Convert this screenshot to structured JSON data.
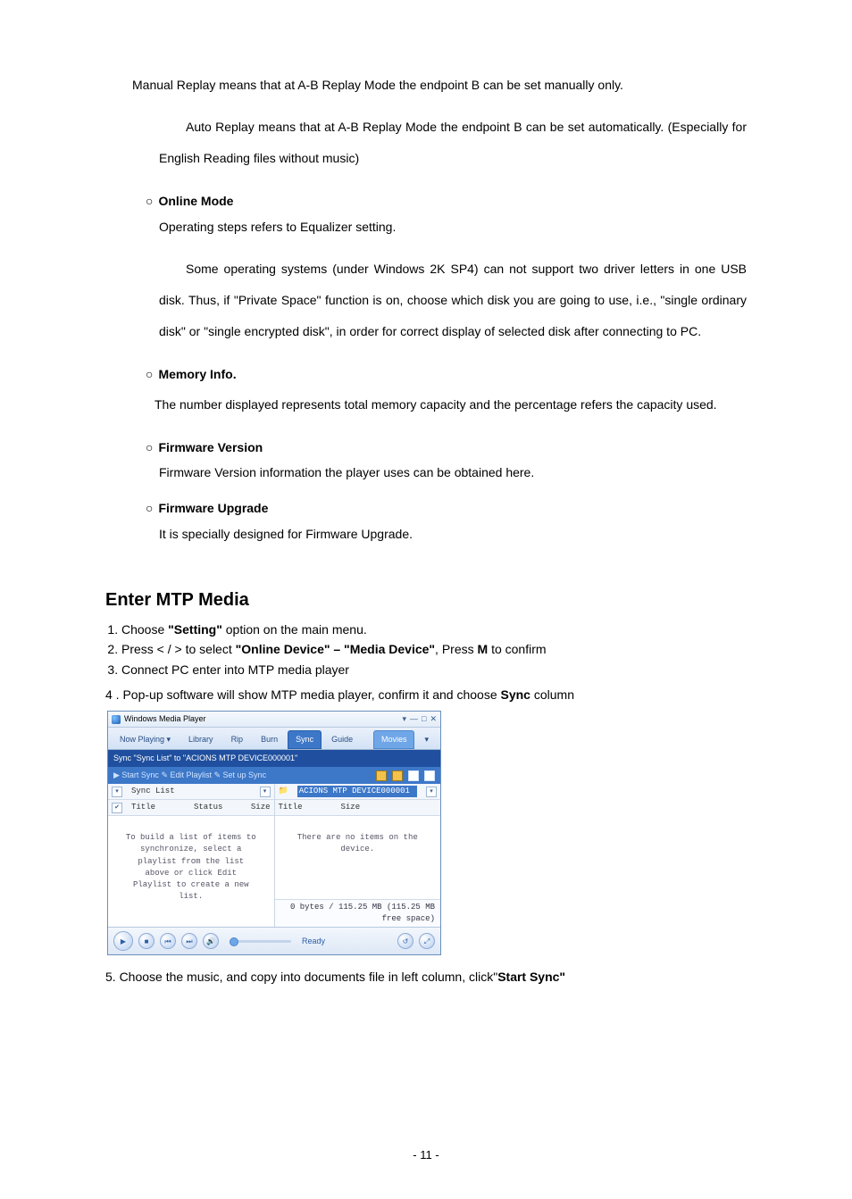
{
  "p_manual": "Manual Replay means that at A-B Replay Mode the endpoint B can be set manually only.",
  "p_auto": "Auto Replay means that at A-B Replay Mode the endpoint B can be set automatically. (Especially for English Reading files without music)",
  "bullet": "○",
  "h_online": "Online Mode",
  "p_online1": "Operating steps refers to Equalizer setting.",
  "p_online2": "Some operating systems (under Windows 2K SP4) can not support two driver letters in one USB disk. Thus, if \"Private Space\" function is on, choose which disk you are going to use, i.e., \"single ordinary disk\" or \"single encrypted disk\", in order for correct display of selected disk after connecting to PC.",
  "h_memory": "Memory Info.",
  "p_memory": "The number displayed represents total memory capacity and the percentage refers the capacity used.",
  "h_fwver": "Firmware Version",
  "p_fwver": "Firmware Version information the player uses can be obtained here.",
  "h_fwup": "Firmware Upgrade",
  "p_fwup": "It is specially designed for Firmware Upgrade.",
  "section": "Enter MTP Media",
  "step1_a": "Choose ",
  "step1_b": "\"Setting\"",
  "step1_c": " option on the main menu.",
  "step2_a": "Press < / > to select ",
  "step2_b": "\"Online Device\" – \"Media Device\"",
  "step2_c": ", Press ",
  "step2_d": "M",
  "step2_e": " to confirm",
  "step3": "Connect PC enter into MTP media player",
  "step4_pre": "4 .   Pop-up software will show MTP media player, confirm it and choose ",
  "step4_b": "Sync",
  "step4_c": " column",
  "step5_a": "5. Choose the music, and copy into documents file in left column, click\"",
  "step5_b": "Start Sync\"",
  "wmp": {
    "title": "Windows Media Player",
    "tabs": {
      "now": "Now Playing  ▾",
      "library": "Library",
      "rip": "Rip",
      "burn": "Burn",
      "sync": "Sync",
      "guide": "Guide",
      "extra": "Movies"
    },
    "sub1": "Sync \"Sync List\" to \"ACIONS MTP DEVICE000001\"",
    "sub2_left": "▶ Start Sync  ✎ Edit Playlist  ✎ Set up Sync",
    "left": {
      "drop": "Sync List",
      "col_title": "Title",
      "col_status": "Status",
      "col_size": "Size",
      "msg": "To build a list of items to synchronize, select a playlist from the list above or click Edit Playlist to create a new list."
    },
    "right": {
      "drop": "ACIONS MTP DEVICE000001",
      "col_title": "Title",
      "col_size": "Size",
      "msg": "There are no items on the device.",
      "foot": "0 bytes / 115.25 MB (115.25 MB free space)"
    },
    "ready": "Ready"
  },
  "page_num": "- 11 -"
}
